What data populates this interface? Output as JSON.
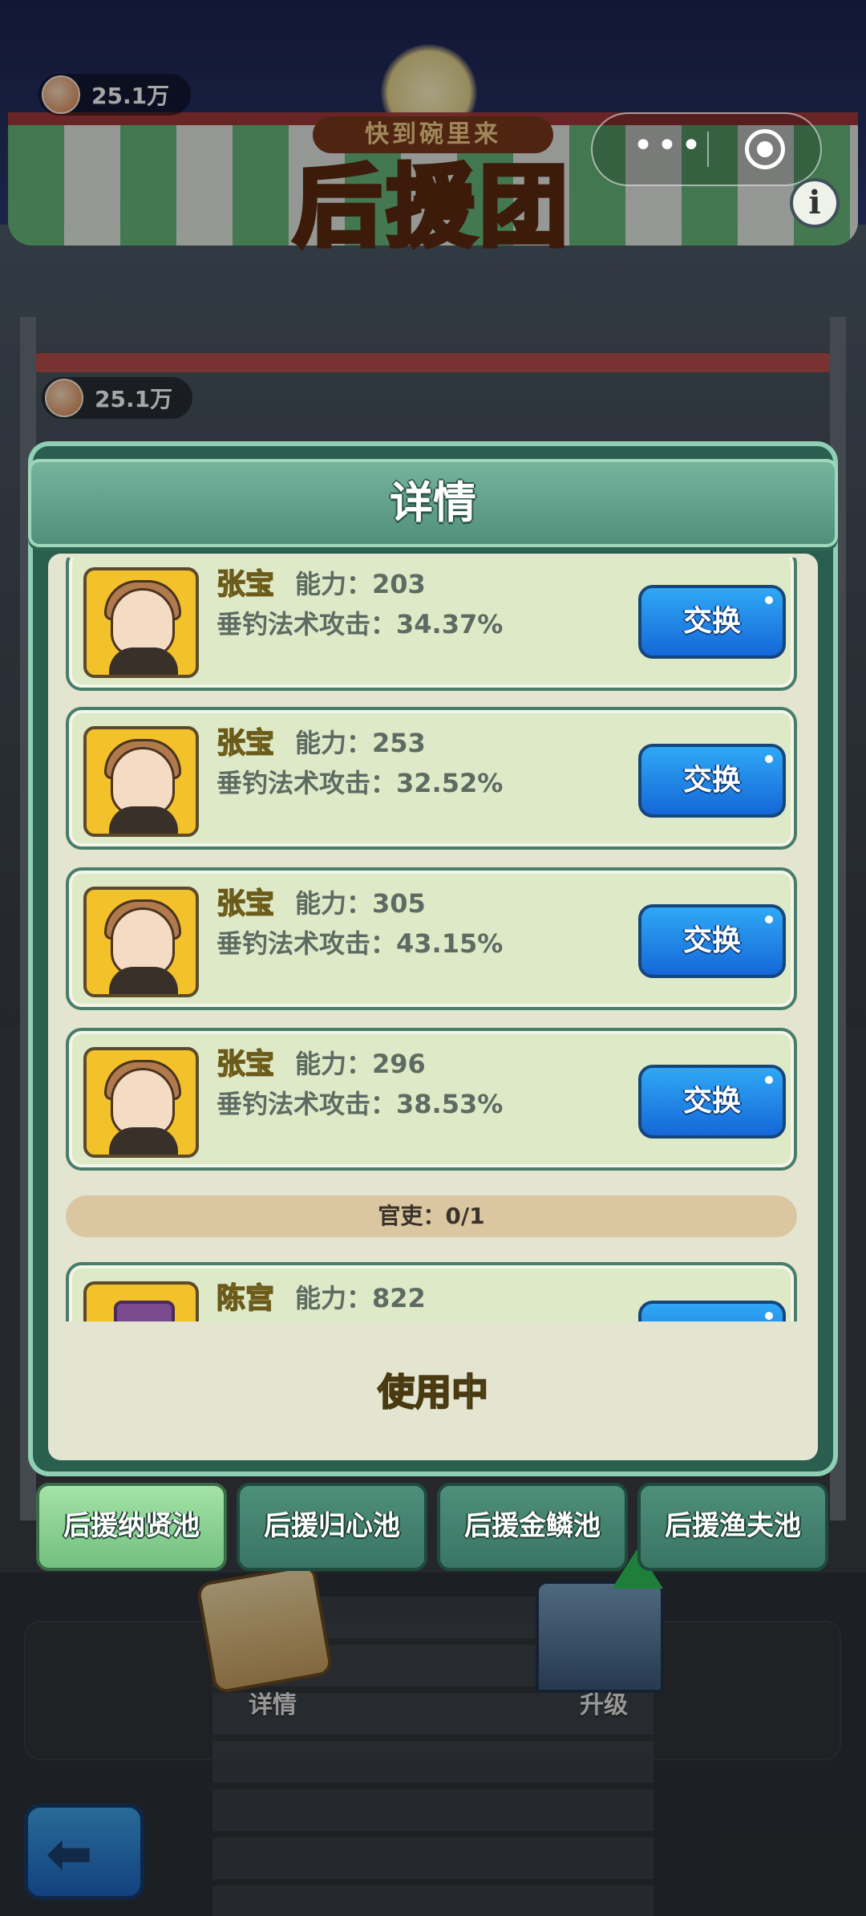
{
  "game": {
    "logo_sub": "快到碗里来",
    "logo_main": "后援团",
    "coins_top": "25.1万",
    "coins_panel": "25.1万"
  },
  "system": {
    "menu_glyph": "•••",
    "info_glyph": "i"
  },
  "panel": {
    "title": "详情",
    "cards": [
      {
        "name": "张宝",
        "power": "能力：203",
        "attack": "垂钓法术攻击：34.37%",
        "button": "交换"
      },
      {
        "name": "张宝",
        "power": "能力：253",
        "attack": "垂钓法术攻击：32.52%",
        "button": "交换"
      },
      {
        "name": "张宝",
        "power": "能力：305",
        "attack": "垂钓法术攻击：43.15%",
        "button": "交换"
      },
      {
        "name": "张宝",
        "power": "能力：296",
        "attack": "垂钓法术攻击：38.53%",
        "button": "交换"
      }
    ],
    "section": "官吏：0/1",
    "partial_card": {
      "name": "陈宫",
      "power": "能力：822"
    },
    "status": "使用中"
  },
  "tabs": [
    {
      "label": "后援纳贤池",
      "active": true
    },
    {
      "label": "后援归心池",
      "active": false
    },
    {
      "label": "后援金鳞池",
      "active": false
    },
    {
      "label": "后援渔夫池",
      "active": false
    }
  ],
  "bottom": {
    "details_label": "详情",
    "upgrade_label": "升级",
    "back_glyph": "⬅"
  },
  "colors": {
    "accent_green": "#4f8e79",
    "swap_blue": "#1567d8",
    "name_yellow": "#f7d21f",
    "card_bg": "#dde9c7"
  }
}
